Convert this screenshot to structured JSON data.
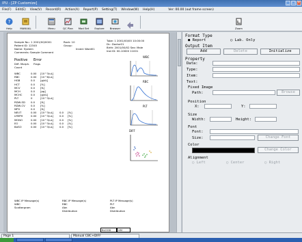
{
  "window": {
    "title": "IPU - [ZP Customize]"
  },
  "menu": [
    "File(F)",
    "Edit(E)",
    "View(V)",
    "Record(R)",
    "Action(A)",
    "Report(P)",
    "Setting(T)",
    "Window(W)",
    "Help(H)"
  ],
  "menu_info": "Ver: 00.00  (out frame screen)",
  "toolbar": {
    "buttons": [
      {
        "label": "Help",
        "icon": "help-icon"
      },
      {
        "label": "MANUAL",
        "icon": "manual-icon"
      },
      {
        "label": "Menu",
        "icon": "menu-icon"
      },
      {
        "label": "QC Plan",
        "icon": "qc-plan-icon"
      },
      {
        "label": "Mod Set",
        "icon": "mod-set-icon"
      },
      {
        "label": "Explore",
        "icon": "explore-icon"
      },
      {
        "label": "Browser",
        "icon": "browser-icon"
      },
      {
        "label": "Zoom",
        "icon": "zoom-icon"
      }
    ]
  },
  "report": {
    "header": [
      "Sample No.:  1   2001/00/0001",
      "Patient ID:  12345",
      "Name:  System",
      "Comments:  Sample Comment"
    ],
    "header_right": [
      "Rack: 10",
      "Group:",
      "Inned:  Ward01"
    ],
    "header_far": [
      "Tube: 1    2001/00/00  10:00:00",
      "Dr.:  Doctor01",
      "Birth:  2001/00/02    Sex: Male",
      "Inst ID:  00-10000 11001"
    ],
    "labels": [
      "Positive",
      "Error"
    ],
    "diff_morph": "Diff. Morph.",
    "count": "Count",
    "flags": "Flags",
    "params": [
      {
        "name": "WBC",
        "value": "0.00",
        "unit": "[10^3/uL]"
      },
      {
        "name": "RBC",
        "value": "0.00",
        "unit": "[10^6/uL]"
      },
      {
        "name": "HGB",
        "value": "0.0",
        "unit": "[g/dL]"
      },
      {
        "name": "HCT",
        "value": "0.0",
        "unit": "[%]"
      },
      {
        "name": "MCV",
        "value": "0.0",
        "unit": "[fL]"
      },
      {
        "name": "MCH",
        "value": "0.0",
        "unit": "[pg]"
      },
      {
        "name": "MCHC",
        "value": "0.0",
        "unit": "[g/dL]"
      },
      {
        "name": "PLT",
        "value": "0",
        "unit": "[10^3/uL]"
      },
      {
        "name": "RDW-SD",
        "value": "0.0",
        "unit": "[fL]"
      },
      {
        "name": "RDW-CV",
        "value": "0.0",
        "unit": "[%]"
      },
      {
        "name": "MPV",
        "value": "0.0",
        "unit": "[fL]"
      },
      {
        "name": "NEUT",
        "value": "0.00",
        "unit": "[10^3/uL]",
        "pct": "0.0",
        "pct_unit": "[%]"
      },
      {
        "name": "LYMPH",
        "value": "0.00",
        "unit": "[10^3/uL]",
        "pct": "0.0",
        "pct_unit": "[%]"
      },
      {
        "name": "MONO",
        "value": "0.00",
        "unit": "[10^3/uL]",
        "pct": "0.0",
        "pct_unit": "[%]"
      },
      {
        "name": "EO",
        "value": "0.00",
        "unit": "[10^3/uL]",
        "pct": "0.0",
        "pct_unit": "[%]"
      },
      {
        "name": "BASO",
        "value": "0.00",
        "unit": "[10^3/uL]",
        "pct": "0.0",
        "pct_unit": "[%]"
      }
    ],
    "graphs": [
      "WBC",
      "RBC",
      "PLT",
      "DIFF"
    ],
    "messages": [
      {
        "title": "WBC IP Message(s)",
        "lines": [
          "WBC",
          "Scattergram"
        ]
      },
      {
        "title": "RBC IP Message(s)",
        "lines": [
          "RBC",
          "Abn",
          "Distribution"
        ]
      },
      {
        "title": "PLT IP Message(s)",
        "lines": [
          "PLT",
          "Abn",
          "Distribution"
        ]
      }
    ],
    "footer_cells": [
      "BLOOD",
      "XM"
    ]
  },
  "panel": {
    "format_type": "Format Type",
    "report_opt": "Report",
    "lab_opt": "Lab. Only",
    "output_item": "Output Item",
    "add_btn": "Add",
    "delete_btn": "Delete",
    "initialize_btn": "Initialize",
    "property": "Property",
    "data_lbl": "Data:",
    "type_lbl": "Type:",
    "item_lbl": "Item:",
    "text_lbl": "Text:",
    "fixed_image": "Fixed Image",
    "path_lbl": "Path:",
    "browse_btn": "Browse",
    "position": "Position",
    "x_lbl": "X:",
    "y_lbl": "Y:",
    "size": "Size",
    "width_lbl": "Width:",
    "height_lbl": "Height:",
    "font": "Font",
    "font_lbl": "Font:",
    "fsize_lbl": "Size:",
    "change_font_btn": "Change Font",
    "color": "Color",
    "color_value": "#000000",
    "change_color_btn": "Change Color",
    "alignment": "Alignment",
    "align_left": "Left",
    "align_center": "Center",
    "align_right": "Right"
  },
  "status": {
    "page": "Page 1",
    "mode": "Manual  CBC+DIFF"
  }
}
